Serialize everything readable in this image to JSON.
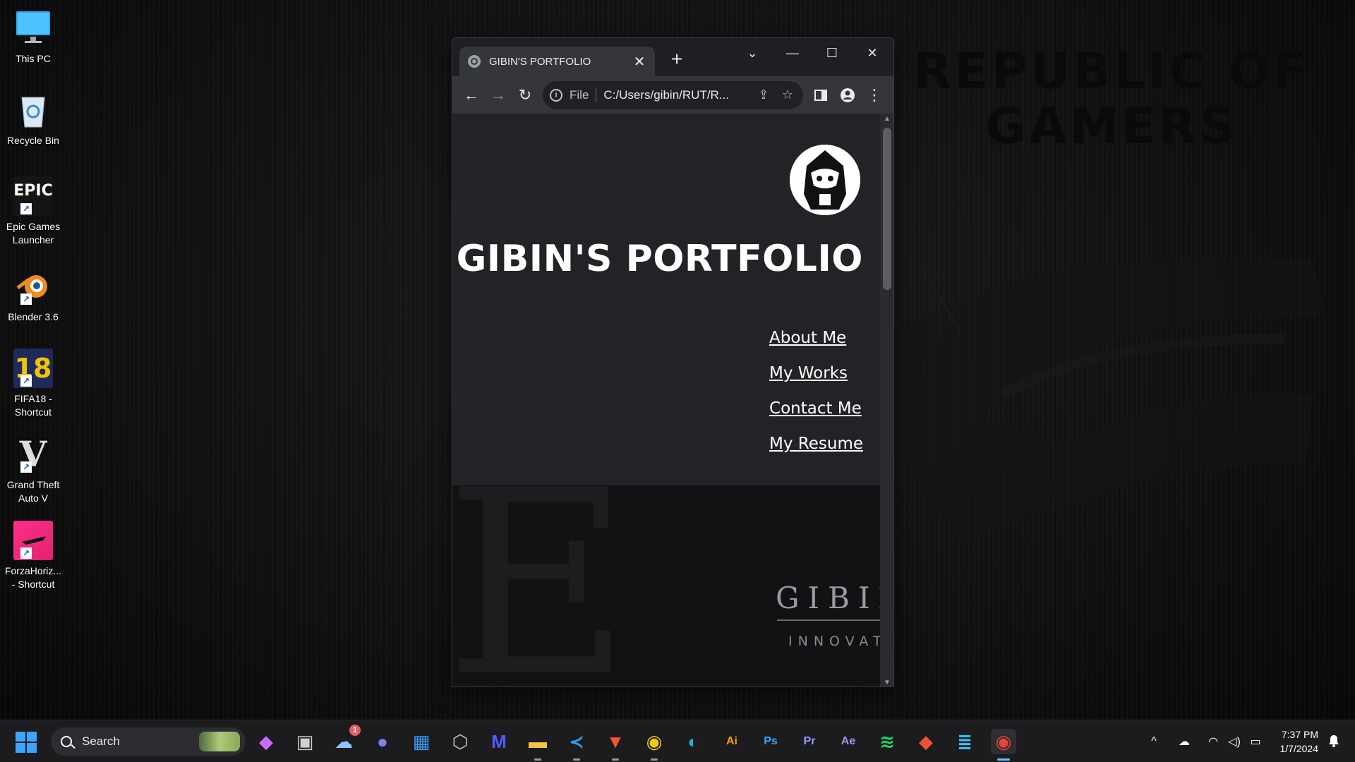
{
  "wallpaper": {
    "text_line1": "REPUBLIC OF",
    "text_line2": "GAMERS"
  },
  "desktop_icons": [
    {
      "label": "This PC",
      "icon": "monitor-icon"
    },
    {
      "label": "Recycle Bin",
      "icon": "recycle-bin-icon"
    },
    {
      "label": "Epic Games Launcher",
      "icon": "epic-games-icon",
      "logo_text": "EPIC"
    },
    {
      "label": "Blender 3.6",
      "icon": "blender-icon"
    },
    {
      "label": "FIFA18 - Shortcut",
      "icon": "fifa-icon",
      "logo_text": "18"
    },
    {
      "label": "Grand Theft Auto V",
      "icon": "gta-icon",
      "logo_text": "V"
    },
    {
      "label": "ForzaHoriz... - Shortcut",
      "icon": "forza-icon"
    }
  ],
  "browser": {
    "tab_title": "GIBIN'S PORTFOLIO",
    "tab_close": "✕",
    "new_tab": "+",
    "window_controls": {
      "dropdown": "⌄",
      "minimize": "—",
      "maximize": "☐",
      "close": "✕"
    },
    "address": {
      "scheme_label": "File",
      "url": "C:/Users/gibin/RUT/R..."
    },
    "page": {
      "title": "GIBIN'S PORTFOLIO",
      "nav": [
        "About Me",
        "My Works",
        "Contact Me",
        "My Resume"
      ],
      "banner": {
        "big_letter": "E",
        "brand_name": "GIBIN",
        "brand_sub": "INNOVAT"
      }
    }
  },
  "taskbar": {
    "search_placeholder": "Search",
    "apps": [
      {
        "name": "copilot",
        "glyph": "◆",
        "color": "#c86bff"
      },
      {
        "name": "task-view",
        "glyph": "▣",
        "color": "#cfcfcf"
      },
      {
        "name": "weather",
        "glyph": "☁",
        "color": "#8ec5ff",
        "badge": "1"
      },
      {
        "name": "teams",
        "glyph": "●",
        "color": "#7b83eb"
      },
      {
        "name": "store",
        "glyph": "▦",
        "color": "#3aa0ff"
      },
      {
        "name": "unity",
        "glyph": "⬡",
        "color": "#cccccc"
      },
      {
        "name": "mathcad",
        "glyph": "M",
        "color": "#4d5dff"
      },
      {
        "name": "file-explorer",
        "glyph": "▬",
        "color": "#f5c542"
      },
      {
        "name": "vscode",
        "glyph": "≺",
        "color": "#2f9cf0"
      },
      {
        "name": "brave",
        "glyph": "▼",
        "color": "#fb542b"
      },
      {
        "name": "chrome",
        "glyph": "◉",
        "color": "#f2c811"
      },
      {
        "name": "edge",
        "glyph": "◐",
        "color": "#1fb2d3"
      },
      {
        "name": "illustrator",
        "glyph": "Ai",
        "color": "#ff9a00"
      },
      {
        "name": "photoshop",
        "glyph": "Ps",
        "color": "#31a8ff"
      },
      {
        "name": "premiere",
        "glyph": "Pr",
        "color": "#9999ff"
      },
      {
        "name": "after-effects",
        "glyph": "Ae",
        "color": "#9999ff"
      },
      {
        "name": "spotify",
        "glyph": "≋",
        "color": "#1ed760"
      },
      {
        "name": "git",
        "glyph": "◆",
        "color": "#f05032"
      },
      {
        "name": "notepad",
        "glyph": "≣",
        "color": "#35c3ff"
      },
      {
        "name": "chrome-active",
        "glyph": "◉",
        "color": "#ea4335"
      }
    ],
    "tray": {
      "chevron": "^",
      "cloud": "☁",
      "wifi": "◠",
      "volume": "◁)",
      "battery": "▭"
    },
    "time": "7:37 PM",
    "date": "1/7/2024"
  }
}
